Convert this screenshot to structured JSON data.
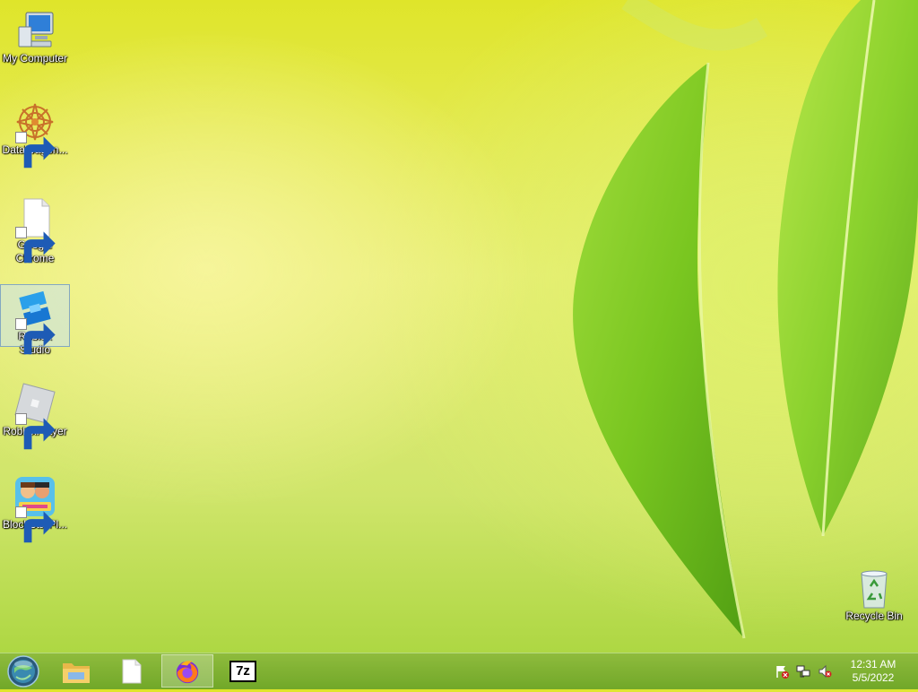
{
  "desktop": {
    "icons": [
      {
        "label": "My Computer",
        "icon": "computer-icon"
      },
      {
        "label": "DataWagon...",
        "icon": "datawagon-icon"
      },
      {
        "label": "Google Chrome",
        "icon": "blank-file-icon"
      },
      {
        "label": "Roblox Studio",
        "icon": "roblox-studio-icon"
      },
      {
        "label": "RobloxPlayer",
        "icon": "roblox-player-icon"
      },
      {
        "label": "BlockStarPl...",
        "icon": "blockstar-icon"
      },
      {
        "label": "Recycle Bin",
        "icon": "recycle-bin-icon"
      }
    ]
  },
  "taskbar": {
    "buttons": [
      {
        "name": "file-explorer",
        "icon": "folder-icon"
      },
      {
        "name": "blank-document",
        "icon": "blank-file-icon"
      },
      {
        "name": "firefox",
        "icon": "firefox-icon"
      },
      {
        "name": "7zip",
        "icon": "7zip-icon",
        "text": "7z"
      }
    ],
    "tray": [
      "action-center-flag-icon",
      "network-icon",
      "volume-muted-icon"
    ],
    "clock": {
      "time": "12:31 AM",
      "date": "5/5/2022"
    }
  }
}
